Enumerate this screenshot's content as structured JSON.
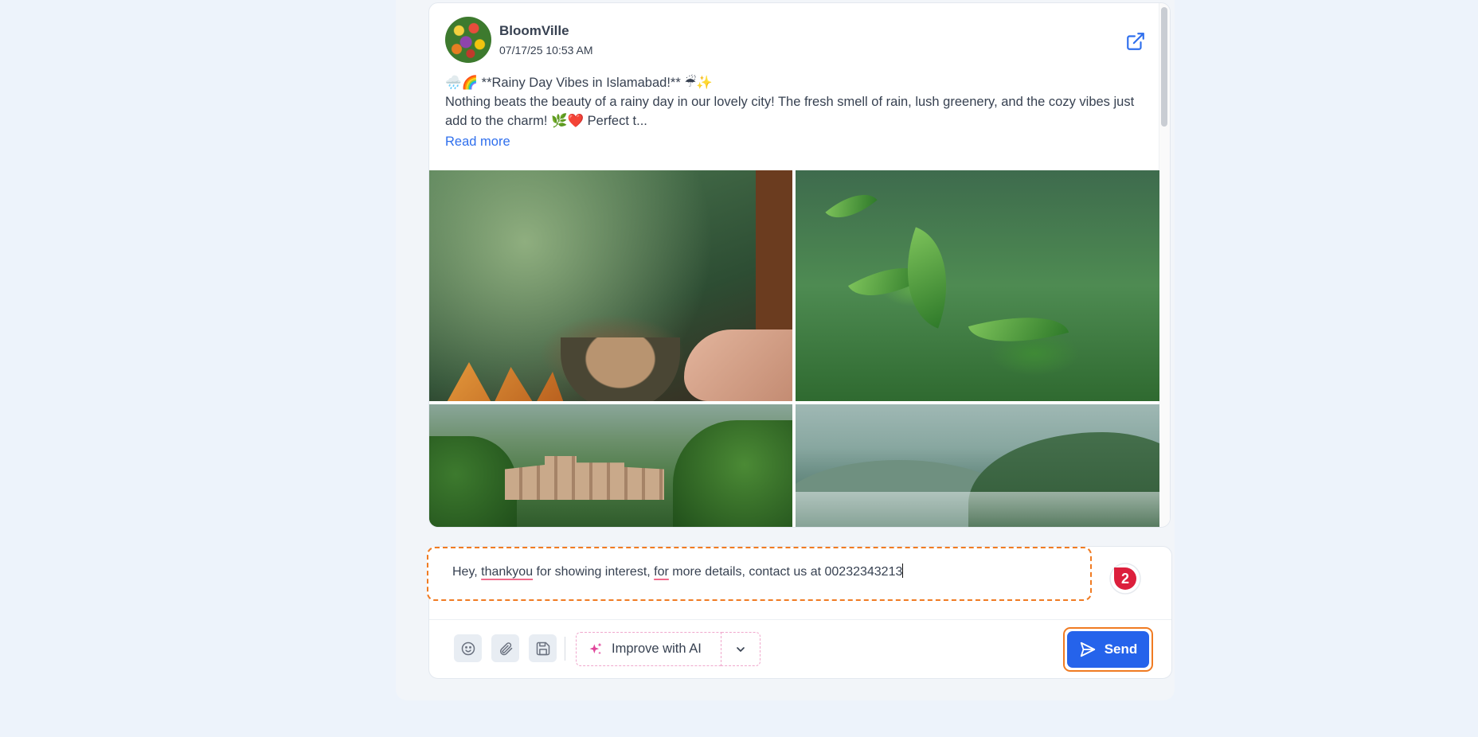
{
  "post": {
    "author": "BloomVille",
    "date": "07/17/25 10:53 AM",
    "title_line": "🌧️🌈 **Rainy Day Vibes in Islamabad!** ☔✨",
    "body": "Nothing beats the beauty of a rainy day in our lovely city! The fresh smell of rain, lush greenery, and the cozy vibes just add to the charm! 🌿❤️ Perfect t...",
    "read_more": "Read more",
    "icons": {
      "avatar": "flower-avatar",
      "external": "external-link-icon"
    },
    "images": [
      "tea-samosa-rain-window",
      "green-leaves-raindrops",
      "city-hills-rain",
      "misty-mountains"
    ]
  },
  "composer": {
    "reply_parts": {
      "p1": "Hey, ",
      "p2": "thankyou",
      "p3": " for showing interest, ",
      "p4": "for",
      "p5": " more details, contact us at 00232343213"
    },
    "grammar_count": "2",
    "tools": [
      "emoji-icon",
      "attachment-icon",
      "save-icon"
    ],
    "ai_button": "Improve with AI",
    "send_button": "Send"
  },
  "colors": {
    "accent": "#2563eb",
    "highlight": "#f07b22",
    "ai_border": "#f0a7cc",
    "badge": "#dc1f3c"
  }
}
